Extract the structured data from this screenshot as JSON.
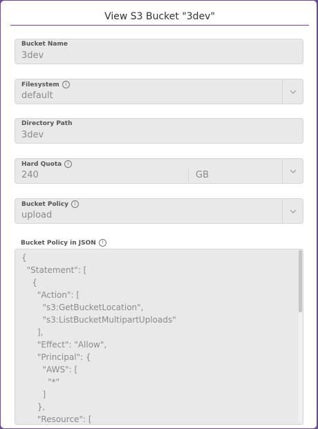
{
  "dialog": {
    "title": "View S3 Bucket \"3dev\""
  },
  "fields": {
    "bucket_name": {
      "label": "Bucket Name",
      "value": "3dev"
    },
    "filesystem": {
      "label": "Filesystem",
      "value": "default"
    },
    "directory_path": {
      "label": "Directory Path",
      "value": "3dev"
    },
    "hard_quota": {
      "label": "Hard Quota",
      "value": "240",
      "unit": "GB"
    },
    "bucket_policy": {
      "label": "Bucket Policy",
      "value": "upload"
    }
  },
  "json_policy": {
    "label": "Bucket Policy in JSON",
    "lines": [
      "{",
      "  \"Statement\": [",
      "    {",
      "      \"Action\": [",
      "        \"s3:GetBucketLocation\",",
      "        \"s3:ListBucketMultipartUploads\"",
      "      ],",
      "      \"Effect\": \"Allow\",",
      "      \"Principal\": {",
      "        \"AWS\": [",
      "          \"*\"",
      "        ]",
      "      },",
      "      \"Resource\": ["
    ]
  },
  "icons": {
    "info": "info-icon",
    "chevron": "chevron-down-icon"
  }
}
